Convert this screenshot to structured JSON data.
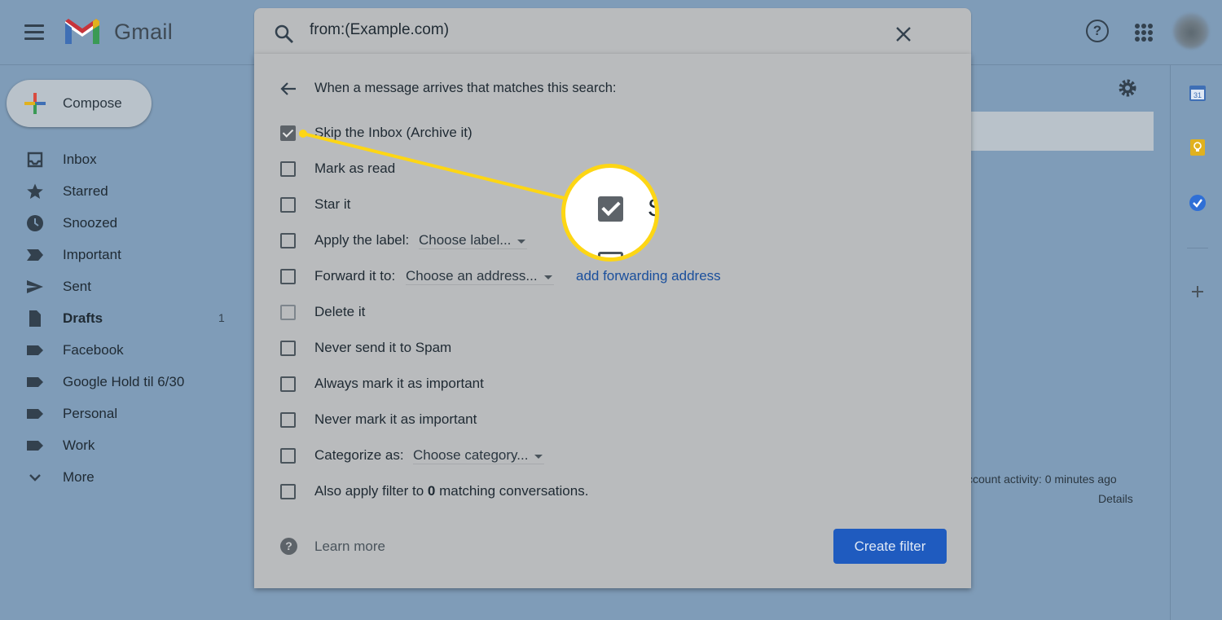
{
  "app": {
    "name": "Gmail"
  },
  "search": {
    "query": "from:(Example.com)"
  },
  "compose": {
    "label": "Compose"
  },
  "sidebar": {
    "items": [
      {
        "label": "Inbox",
        "icon": "inbox-icon"
      },
      {
        "label": "Starred",
        "icon": "star-icon"
      },
      {
        "label": "Snoozed",
        "icon": "clock-icon"
      },
      {
        "label": "Important",
        "icon": "important-icon"
      },
      {
        "label": "Sent",
        "icon": "send-icon"
      },
      {
        "label": "Drafts",
        "icon": "draft-icon",
        "count": "1"
      },
      {
        "label": "Facebook",
        "icon": "label-icon"
      },
      {
        "label": "Google Hold til 6/30",
        "icon": "label-icon"
      },
      {
        "label": "Personal",
        "icon": "label-icon"
      },
      {
        "label": "Work",
        "icon": "label-icon"
      },
      {
        "label": "More",
        "icon": "chevron-down-icon"
      }
    ]
  },
  "filter_dialog": {
    "heading": "When a message arrives that matches this search:",
    "options": {
      "skip_inbox": {
        "label": "Skip the Inbox (Archive it)",
        "checked": true
      },
      "mark_read": {
        "label": "Mark as read",
        "checked": false
      },
      "star_it": {
        "label": "Star it",
        "checked": false
      },
      "apply_label": {
        "label": "Apply the label:",
        "dropdown": "Choose label...",
        "checked": false
      },
      "forward_to": {
        "label": "Forward it to:",
        "dropdown": "Choose an address...",
        "link": "add forwarding address",
        "checked": false
      },
      "delete_it": {
        "label": "Delete it",
        "checked": false
      },
      "never_spam": {
        "label": "Never send it to Spam",
        "checked": false
      },
      "always_important": {
        "label": "Always mark it as important",
        "checked": false
      },
      "never_important": {
        "label": "Never mark it as important",
        "checked": false
      },
      "categorize": {
        "label": "Categorize as:",
        "dropdown": "Choose category...",
        "checked": false
      },
      "also_apply": {
        "label_before": "Also apply filter to ",
        "count": "0",
        "label_after": " matching conversations.",
        "checked": false
      }
    },
    "learn_more": "Learn more",
    "create_button": "Create filter"
  },
  "callout": {
    "zoom_letter": "S"
  },
  "background": {
    "activity": "ccount activity: 0 minutes ago",
    "details": "Details"
  },
  "rail": {
    "calendar_day": "31"
  },
  "colors": {
    "accent": "#fdd614",
    "primary_button": "#1f5bbf",
    "link": "#1a4f9c",
    "page_overlay": "#7f9cb8"
  }
}
